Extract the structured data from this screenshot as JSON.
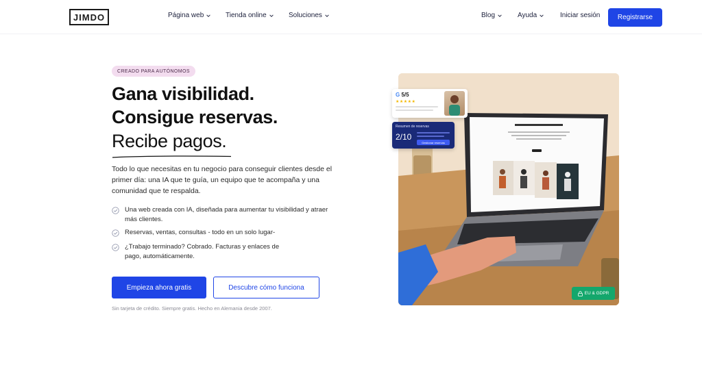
{
  "nav": {
    "logo": "JIMDO",
    "left_items": [
      "Página web",
      "Tienda online",
      "Soluciones"
    ],
    "right_items": [
      "Blog",
      "Ayuda"
    ],
    "login": "Iniciar sesión",
    "register": "Registrarse"
  },
  "hero": {
    "badge": "CREADO PARA AUTÓNOMOS",
    "title_line1": "Gana visibilidad.",
    "title_line2": "Consigue reservas.",
    "title_line3": "Recibe pagos.",
    "description": "Todo lo que necesitas en tu negocio para conseguir clientes desde el primer día: una IA que te guía, un equipo que te acompaña y una comunidad que te respalda.",
    "features": [
      "Una web creada con IA, diseñada para aumentar tu visibilidad y atraer más clientes.",
      "Reservas, ventas, consultas - todo en un solo lugar-",
      "¿Trabajo terminado? Cobrado. Facturas y enlaces de pago, automáticamente."
    ],
    "cta_primary": "Empieza ahora gratis",
    "cta_secondary": "Descubre cómo funciona",
    "footnote": "Sin tarjeta de crédito. Siempre gratis. Hecho en Alemania desde 2007."
  },
  "image_overlays": {
    "review_score": "5/5",
    "review_stars": "★★★★★",
    "booking_title": "Resumen de reservas",
    "booking_count": "2/10",
    "booking_button": "Gestionar reservas",
    "gdpr_badge": "EU & GDPR"
  },
  "colors": {
    "accent": "#1f45e6",
    "badge_bg": "#f3dcef",
    "gdpr_green": "#14a76c",
    "booking_navy": "#1a2a78"
  },
  "icons": {
    "chevron": "chevron-down-icon",
    "check": "check-circle-icon",
    "google": "google-icon",
    "lock": "lock-icon"
  }
}
